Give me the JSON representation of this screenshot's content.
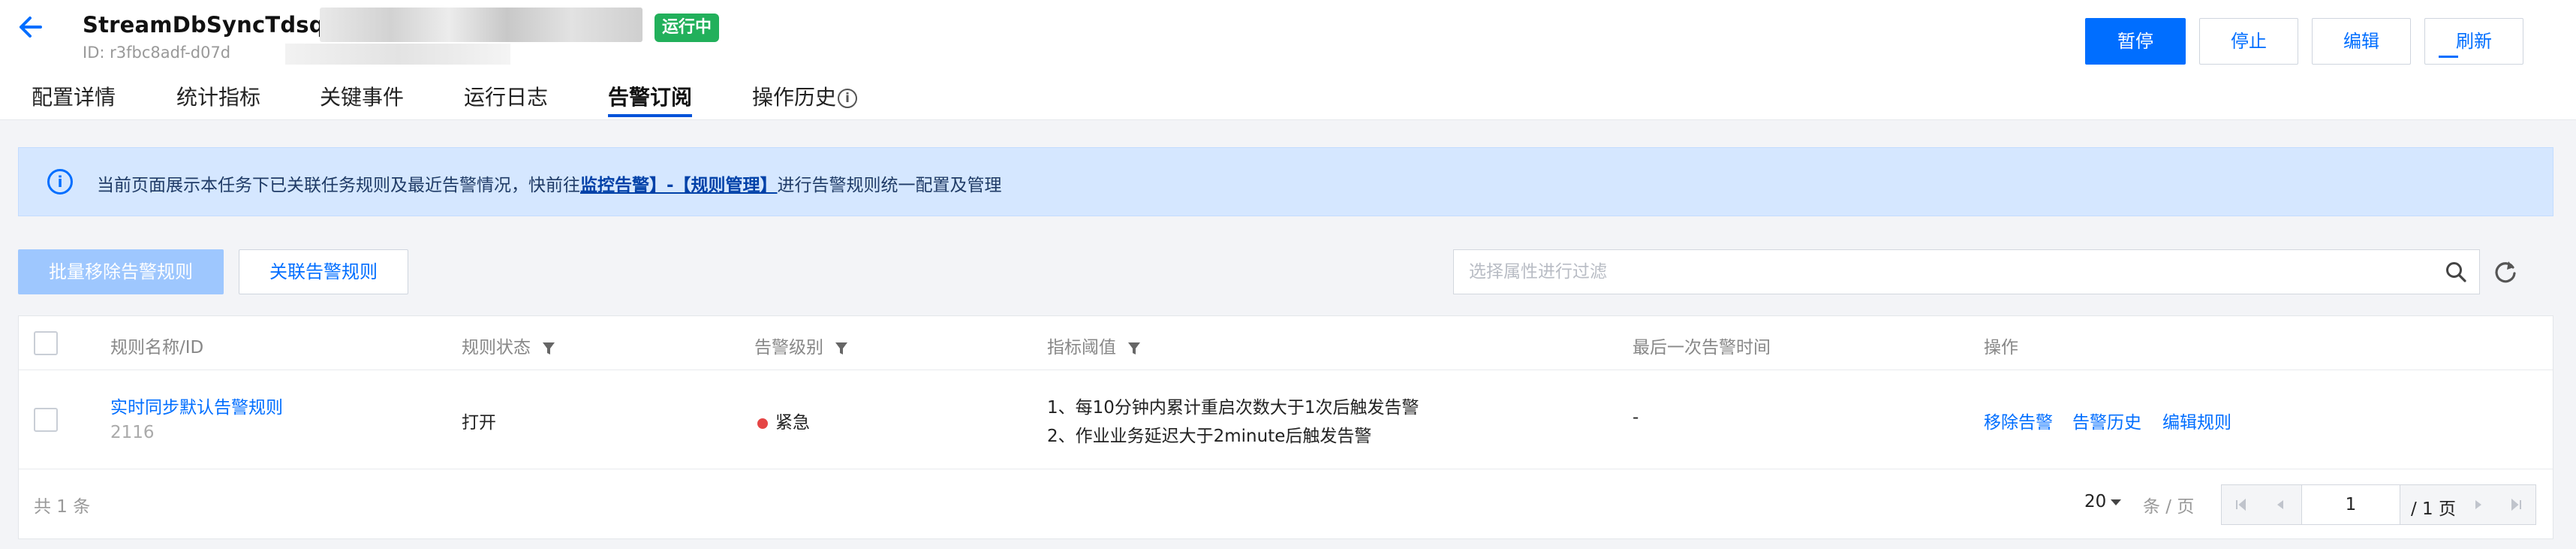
{
  "header": {
    "title": "StreamDbSyncTdsql",
    "subtitle": "ID: r3fbc8adf-d07d",
    "status": "运行中",
    "colors": {
      "accent": "#006eff",
      "status": "#22b05b"
    },
    "actions": {
      "pause": "暂停",
      "stop": "停止",
      "edit": "编辑",
      "refresh": "刷新"
    }
  },
  "tabs": [
    "配置详情",
    "统计指标",
    "关键事件",
    "运行日志",
    "告警订阅",
    "操作历史"
  ],
  "active_tab": "告警订阅",
  "notice": {
    "prefix": "当前页面展示本任务下已关联任务规则及最近告警情况，快前往",
    "link": "监控告警】-【规则管理】",
    "suffix": "进行告警规则统一配置及管理"
  },
  "toolbar": {
    "batch_remove": "批量移除告警规则",
    "associate": "关联告警规则",
    "search_placeholder": "选择属性进行过滤"
  },
  "table": {
    "columns": [
      "规则名称/ID",
      "规则状态",
      "告警级别",
      "指标阈值",
      "最后一次告警时间",
      "操作"
    ],
    "rows": [
      {
        "name": "实时同步默认告警规则",
        "id": "2116",
        "status": "打开",
        "level": "紧急",
        "threshold_1": "1、每10分钟内累计重启次数大于1次后触发告警",
        "threshold_2": "2、作业业务延迟大于2minute后触发告警",
        "last_alarm": "-",
        "ops": {
          "remove": "移除告警",
          "history": "告警历史",
          "edit": "编辑规则"
        }
      }
    ]
  },
  "pagination": {
    "total": "共 1 条",
    "page_size": "20",
    "per_page_unit": "条 / 页",
    "page": "1",
    "total_pages": "/ 1 页"
  }
}
